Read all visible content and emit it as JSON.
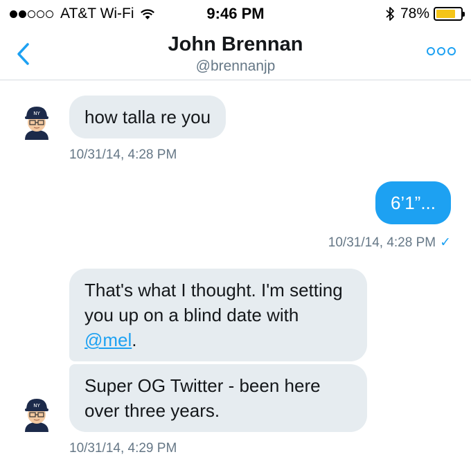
{
  "status_bar": {
    "carrier": "AT&T Wi-Fi",
    "time": "9:46 PM",
    "battery": "78%",
    "battery_level": 0.78,
    "signal_bars": 2
  },
  "header": {
    "name": "John Brennan",
    "handle": "@brennanjp",
    "back_icon": "chevron-left-icon",
    "more_icon": "more-dots-icon"
  },
  "messages": [
    {
      "text": "how talla re you",
      "timestamp": "10/31/14, 4:28 PM"
    },
    {
      "text": "6’1”...",
      "timestamp": "10/31/14, 4:28 PM",
      "read_mark": "✓"
    },
    {
      "text_before": "That's what I thought. I'm setting you up on a blind date with ",
      "mention": "@mel",
      "text_after": "."
    },
    {
      "text": "Super OG Twitter - been here over three years.",
      "timestamp": "10/31/14, 4:29 PM"
    }
  ],
  "colors": {
    "accent": "#1da1f2",
    "bubble_received": "#e6ecf0",
    "battery": "#f5c518"
  }
}
